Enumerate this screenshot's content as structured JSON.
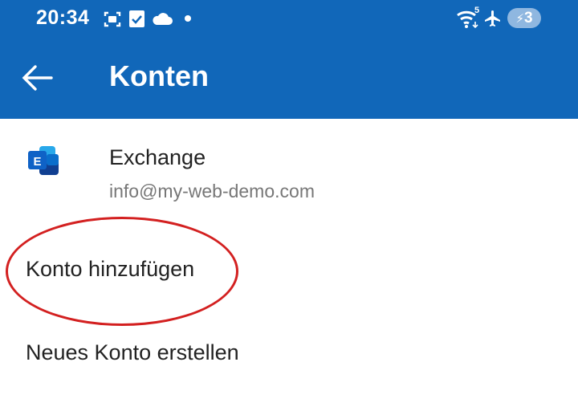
{
  "status_bar": {
    "time": "20:34",
    "left_icons": [
      "screenshot-icon",
      "checkbox-notification-icon",
      "cloud-icon",
      "dot-icon"
    ],
    "wifi_label": "5",
    "right_icons": [
      "wifi-icon",
      "airplane-mode-icon"
    ],
    "battery_level": "3"
  },
  "app_bar": {
    "back_icon": "back-arrow-icon",
    "title": "Konten"
  },
  "account": {
    "icon": "exchange-logo-icon",
    "logo_letter": "E",
    "name": "Exchange",
    "email": "info@my-web-demo.com"
  },
  "menu": {
    "add_account": "Konto hinzufügen",
    "create_account": "Neues Konto erstellen"
  },
  "colors": {
    "header": "#1167b9",
    "highlight": "#d32020",
    "text_primary": "#222222",
    "text_secondary": "#777777"
  }
}
